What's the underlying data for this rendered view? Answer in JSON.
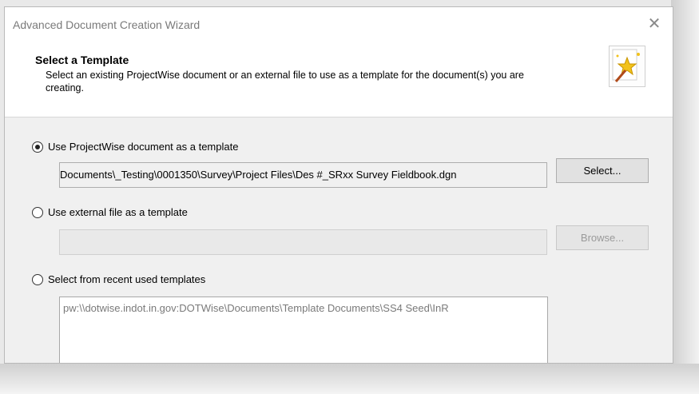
{
  "window": {
    "title": "Advanced Document Creation Wizard",
    "close_symbol": "✕"
  },
  "header": {
    "title": "Select a Template",
    "description": "Select an existing ProjectWise document or an external file to use as a template for the document(s) you are creating.",
    "icon": "wizard-wand-icon"
  },
  "options": {
    "projectwise": {
      "label": "Use ProjectWise document as a template",
      "selected": true,
      "path": "Documents\\_Testing\\0001350\\Survey\\Project Files\\Des #_SRxx Survey Fieldbook.dgn",
      "button_label": "Select..."
    },
    "external": {
      "label": "Use external file as a template",
      "selected": false,
      "path": "",
      "button_label": "Browse..."
    },
    "recent": {
      "label": "Select from recent used templates",
      "selected": false,
      "items": [
        "pw:\\\\dotwise.indot.in.gov:DOTWise\\Documents\\Template Documents\\SS4 Seed\\InR"
      ]
    }
  }
}
